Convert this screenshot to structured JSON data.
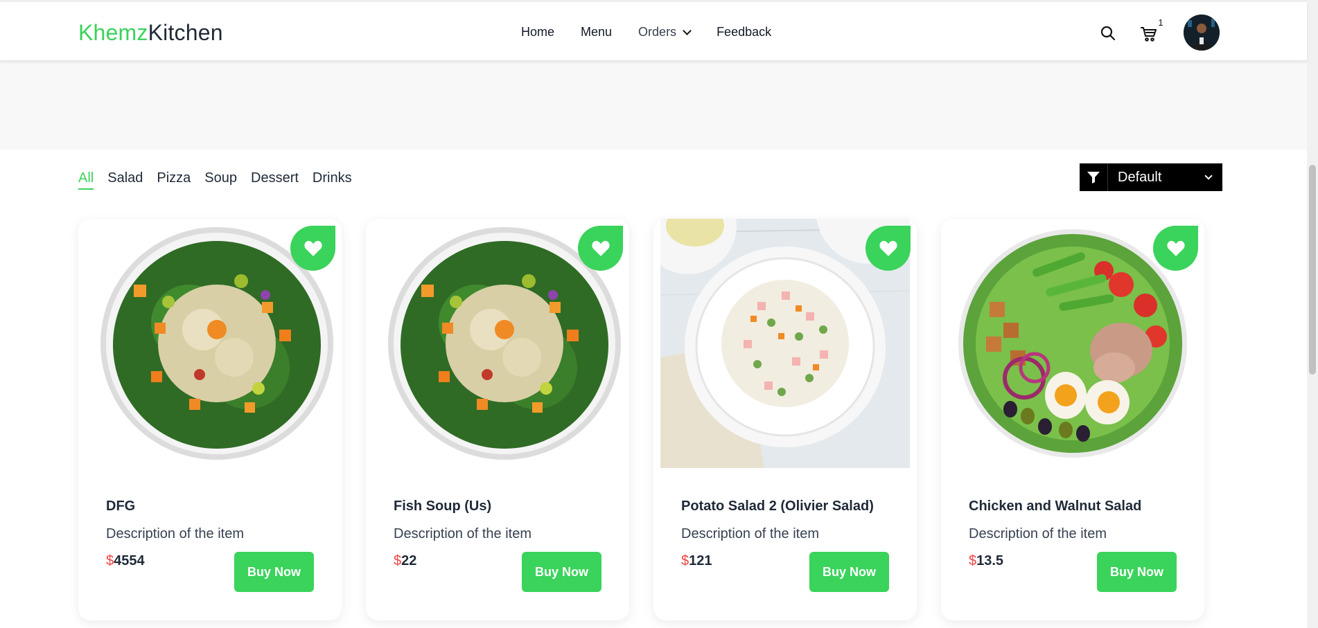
{
  "brand": {
    "part1": "Khemz",
    "part2": "Kitchen"
  },
  "nav": {
    "home": "Home",
    "menu": "Menu",
    "orders": "Orders",
    "feedback": "Feedback"
  },
  "cart": {
    "count": "1"
  },
  "filters": [
    "All",
    "Salad",
    "Pizza",
    "Soup",
    "Dessert",
    "Drinks"
  ],
  "sort": {
    "selected": "Default"
  },
  "currency": "$",
  "buy_label": "Buy Now",
  "items": [
    {
      "title": "DFG",
      "description": "Description of the item",
      "price": "4554"
    },
    {
      "title": "Fish Soup (Us)",
      "description": "Description of the item",
      "price": "22"
    },
    {
      "title": "Potato Salad 2 (Olivier Salad)",
      "description": "Description of the item",
      "price": "121"
    },
    {
      "title": "Chicken and Walnut Salad",
      "description": "Description of the item",
      "price": "13.5"
    }
  ],
  "colors": {
    "accent": "#3ad35b",
    "price_symbol": "#ef4444",
    "sort_bg": "#000000"
  }
}
